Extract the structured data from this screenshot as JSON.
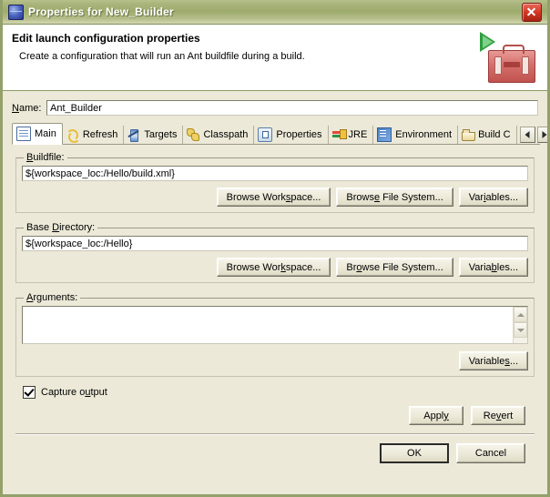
{
  "window": {
    "title": "Properties for New_Builder",
    "icon": "globe-icon",
    "close_label": "×",
    "titlebar_color": "#a9b47b",
    "border_color": "#93a06a",
    "close_color": "#cf3520"
  },
  "header": {
    "title": "Edit launch configuration properties",
    "description": "Create a configuration that will run an Ant buildfile during a build.",
    "graphic": "ant-toolbox-icon",
    "toolbox_color": "#d4706c",
    "play_color": "#2f9e3f"
  },
  "name_field": {
    "label": "Name:",
    "value": "Ant_Builder",
    "placeholder": ""
  },
  "tabs": {
    "selected": "Main",
    "items": [
      {
        "label": "Main",
        "icon": "document-icon",
        "selected": true
      },
      {
        "label": "Refresh",
        "icon": "refresh-icon",
        "selected": false
      },
      {
        "label": "Targets",
        "icon": "target-icon",
        "selected": false
      },
      {
        "label": "Classpath",
        "icon": "classpath-icon",
        "selected": false
      },
      {
        "label": "Properties",
        "icon": "properties-icon",
        "selected": false
      },
      {
        "label": "JRE",
        "icon": "jre-icon",
        "selected": false
      },
      {
        "label": "Environment",
        "icon": "environment-icon",
        "selected": false
      },
      {
        "label": "Build C",
        "icon": "build-icon",
        "selected": false
      }
    ],
    "scroll_left": "◀",
    "scroll_right": "▶"
  },
  "buildfile": {
    "legend": "Buildfile:",
    "value": "${workspace_loc:/Hello/build.xml}",
    "browse_workspace": "Browse Workspace...",
    "browse_filesystem": "Browse File System...",
    "variables": "Variables..."
  },
  "base_directory": {
    "legend": "Base Directory:",
    "value": "${workspace_loc:/Hello}",
    "browse_workspace": "Browse Workspace...",
    "browse_filesystem": "Browse File System...",
    "variables": "Variables..."
  },
  "arguments": {
    "legend": "Arguments:",
    "value": "",
    "placeholder": "",
    "variables": "Variables...",
    "scroll_up": "▲",
    "scroll_down": "▼"
  },
  "capture_output": {
    "label": "Capture output",
    "checked": true
  },
  "apply_bar": {
    "apply": "Apply",
    "revert": "Revert"
  },
  "ok_bar": {
    "ok": "OK",
    "cancel": "Cancel"
  }
}
